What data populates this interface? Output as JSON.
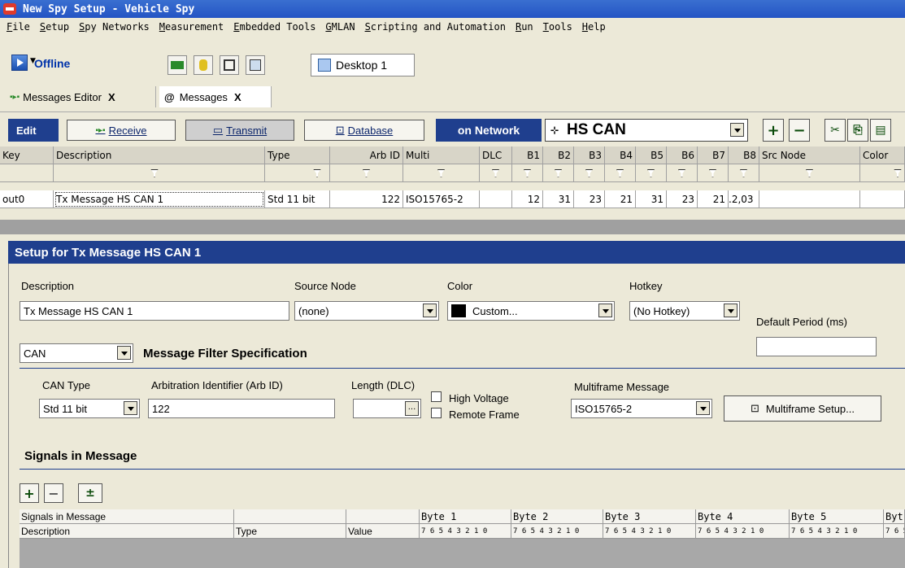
{
  "window": {
    "title": "New Spy Setup - Vehicle Spy"
  },
  "menu": [
    "File",
    "Setup",
    "Spy Networks",
    "Measurement",
    "Embedded Tools",
    "GMLAN",
    "Scripting and Automation",
    "Run",
    "Tools",
    "Help"
  ],
  "toolbar": {
    "status": "Offline",
    "desktop_tab": "Desktop 1"
  },
  "doc_tabs": [
    {
      "label": "Messages Editor",
      "close": "X"
    },
    {
      "label": "Messages",
      "close": "X"
    }
  ],
  "editbar": {
    "edit_label": "Edit",
    "receive": "Receive",
    "transmit": "Transmit",
    "database": "Database",
    "on_network": "on Network",
    "network": "HS CAN",
    "add": "+",
    "remove": "−"
  },
  "grid": {
    "headers": [
      "Key",
      "Description",
      "Type",
      "Arb ID",
      "Multi",
      "DLC",
      "B1",
      "B2",
      "B3",
      "B4",
      "B5",
      "B6",
      "B7",
      "B8",
      "Src Node",
      "Color"
    ],
    "row": {
      "key": "out0",
      "description": "Tx Message HS CAN 1",
      "type": "Std 11 bit",
      "arb_id": "122",
      "multi": "ISO15765-2",
      "dlc": "",
      "b1": "12",
      "b2": "31",
      "b3": "23",
      "b4": "21",
      "b5": "31",
      "b6": "23",
      "b7": "21",
      "b8": ".2,03",
      "src": "",
      "color": ""
    }
  },
  "setup": {
    "title": "Setup for Tx Message HS CAN 1",
    "description_label": "Description",
    "description_value": "Tx Message HS CAN 1",
    "source_node_label": "Source Node",
    "source_node_value": "(none)",
    "color_label": "Color",
    "color_value": "Custom...",
    "color_swatch": "#000000",
    "hotkey_label": "Hotkey",
    "hotkey_value": "(No Hotkey)",
    "default_period_label": "Default Period (ms)",
    "default_period_value": "",
    "protocol_value": "CAN",
    "filter_spec_label": "Message Filter Specification",
    "can_type_label": "CAN Type",
    "can_type_value": "Std 11 bit",
    "arb_id_label": "Arbitration Identifier (Arb ID)",
    "arb_id_value": "122",
    "length_label": "Length (DLC)",
    "length_value": "",
    "high_voltage_label": "High Voltage",
    "remote_frame_label": "Remote Frame",
    "multiframe_label": "Multiframe Message",
    "multiframe_value": "ISO15765-2",
    "multiframe_setup": "Multiframe Setup...",
    "signals_label": "Signals in Message"
  },
  "signals_table": {
    "group_header": "Signals in Message",
    "col_description": "Description",
    "col_type": "Type",
    "col_value": "Value",
    "bytes": [
      "Byte 1",
      "Byte 2",
      "Byte 3",
      "Byte 4",
      "Byte 5",
      "Byt"
    ],
    "bits": "7 6 5 4 3 2 1 0"
  },
  "colors": {
    "title_blue": "#2454c4",
    "header_navy": "#1f3f8e",
    "panel_bg": "#ece9d8"
  }
}
